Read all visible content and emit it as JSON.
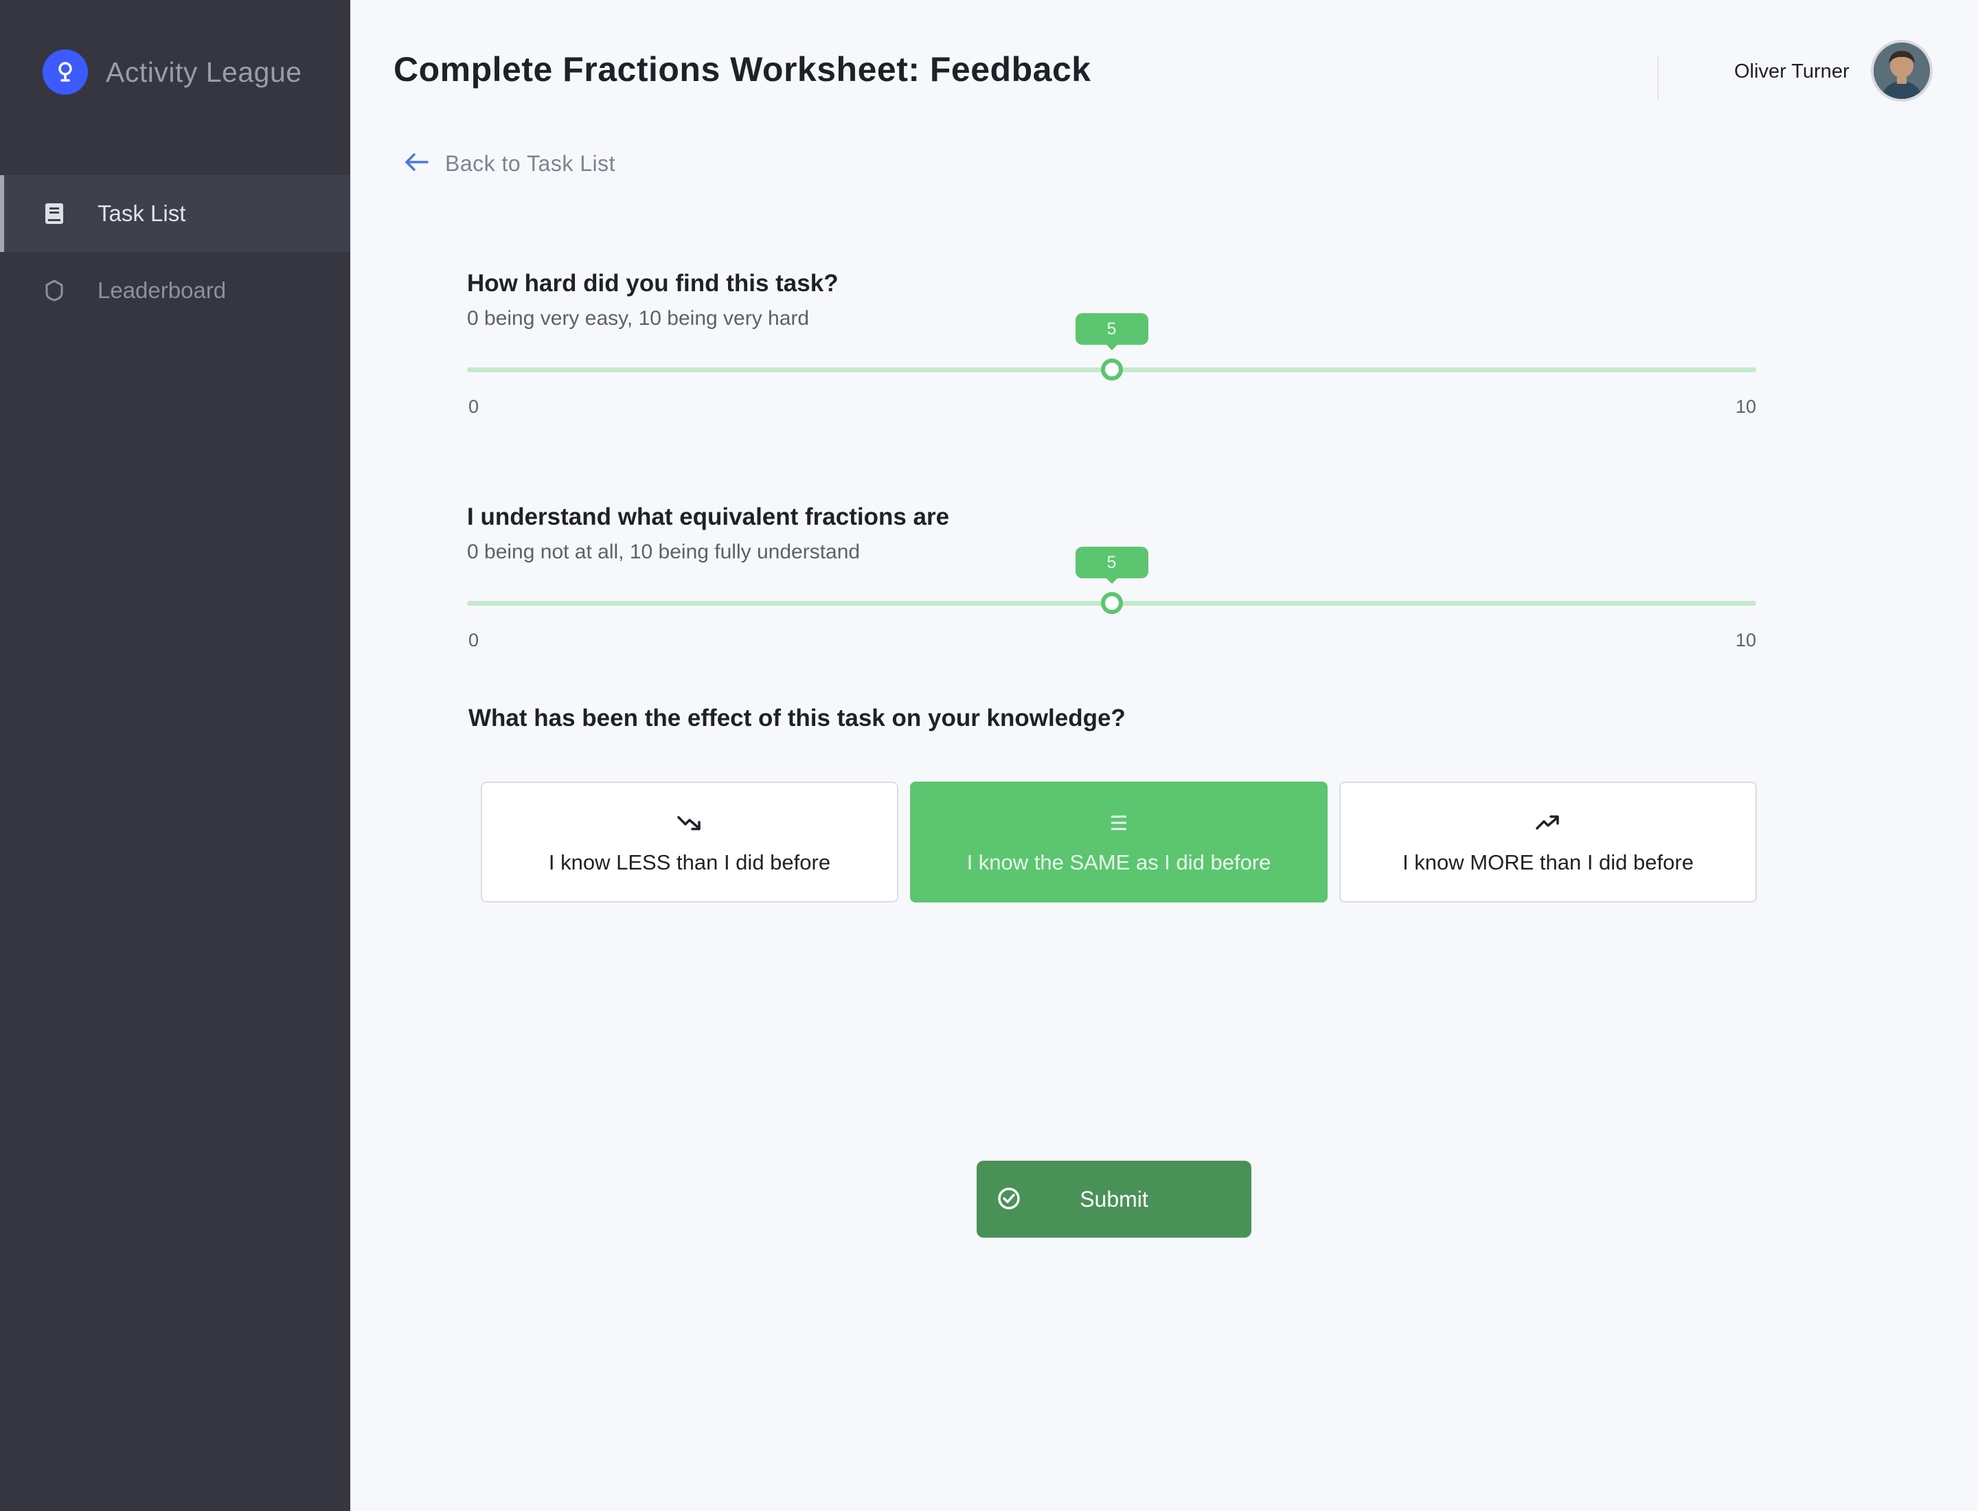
{
  "app": {
    "name": "Activity League"
  },
  "sidebar": {
    "items": [
      {
        "label": "Task List",
        "icon": "book-icon",
        "active": true
      },
      {
        "label": "Leaderboard",
        "icon": "shield-icon",
        "active": false
      }
    ]
  },
  "header": {
    "title": "Complete Fractions Worksheet: Feedback",
    "user_name": "Oliver Turner"
  },
  "back_link": {
    "label": "Back to Task List"
  },
  "questions": [
    {
      "title": "How hard did you find this task?",
      "subtitle": "0 being very easy, 10 being very hard",
      "min": "0",
      "max": "10",
      "value": "5"
    },
    {
      "title": "I understand what equivalent fractions are",
      "subtitle": "0 being not at all, 10 being fully understand",
      "min": "0",
      "max": "10",
      "value": "5"
    }
  ],
  "effect": {
    "title": "What has been the effect of this task on your knowledge?",
    "options": [
      {
        "label": "I know LESS than I did before",
        "icon": "trend-down-icon",
        "selected": false
      },
      {
        "label": "I know the SAME as I did before",
        "icon": "equals-icon",
        "selected": true
      },
      {
        "label": "I know MORE than I did before",
        "icon": "trend-up-icon",
        "selected": false
      }
    ]
  },
  "submit": {
    "label": "Submit"
  },
  "colors": {
    "sidebar_bg": "#353640",
    "brand_accent": "#3d5afe",
    "success_green": "#5cc56f",
    "submit_green": "#4a9158",
    "page_bg": "#f7f8fb"
  }
}
